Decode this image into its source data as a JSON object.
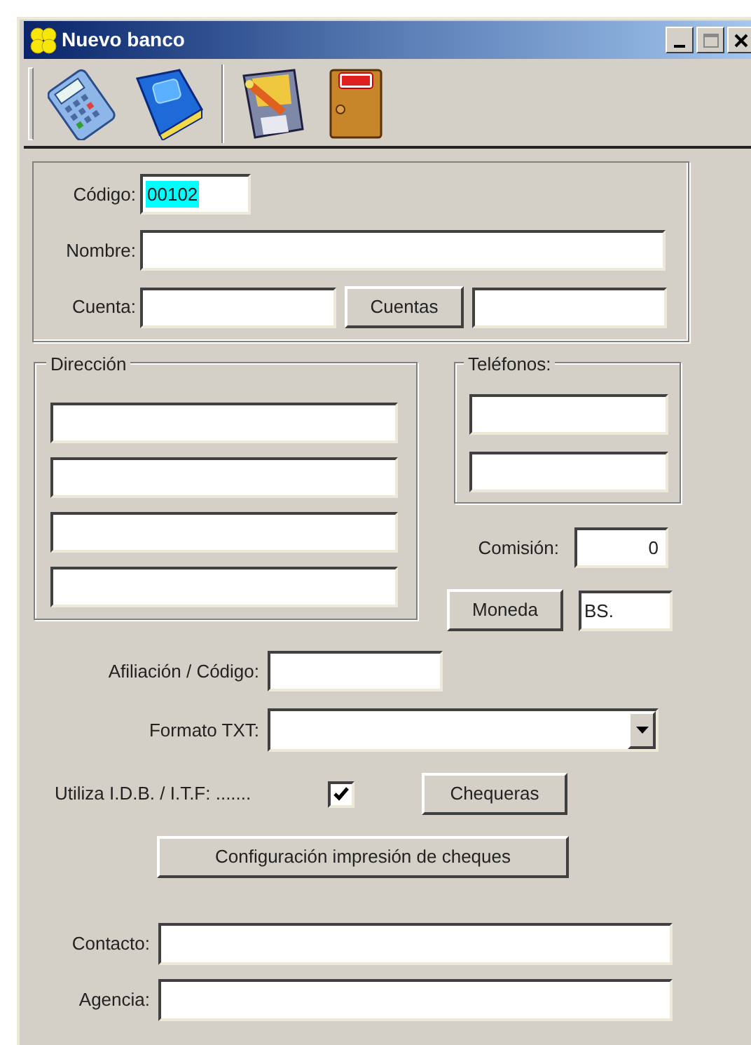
{
  "window": {
    "title": "Nuevo banco"
  },
  "general": {
    "codigo": {
      "label": "Código:",
      "value": "00102",
      "highlighted": true
    },
    "nombre": {
      "label": "Nombre:"
    },
    "cuenta": {
      "label": "Cuenta:"
    },
    "cuentas_button": "Cuentas"
  },
  "direccion": {
    "title": "Dirección"
  },
  "telefonos": {
    "title": "Teléfonos:"
  },
  "comision": {
    "label": "Comisión:",
    "value": "0"
  },
  "moneda": {
    "button": "Moneda",
    "value": "BS."
  },
  "afiliacion": {
    "label": "Afiliación / Código:"
  },
  "formato_txt": {
    "label": "Formato TXT:"
  },
  "utiliza_idb_itf": {
    "label": "Utiliza I.D.B. / I.T.F: .......",
    "checked": true
  },
  "chequeras_button": "Chequeras",
  "configuracion_button": "Configuración impresión de cheques",
  "contacto": {
    "label": "Contacto:"
  },
  "agencia": {
    "label": "Agencia:"
  }
}
